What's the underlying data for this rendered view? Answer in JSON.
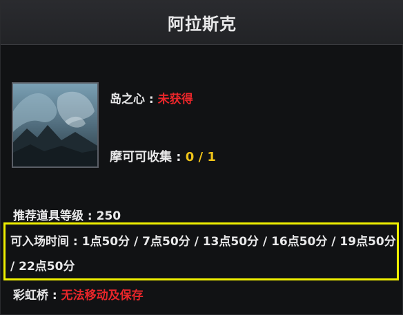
{
  "header": {
    "title": "阿拉斯克"
  },
  "thumbnail": {
    "icon": "island-landscape-icon"
  },
  "island_heart": {
    "label": "岛之心 : ",
    "value": "未获得"
  },
  "collectibles": {
    "label": "摩可可收集 : ",
    "value": "0 / 1"
  },
  "recommended_level": {
    "label": "推荐道具等级 : ",
    "value": "250"
  },
  "entry_time": {
    "label": "可入场时间 : ",
    "value": "1点50分 / 7点50分 / 13点50分 / 16点50分 / 19点50分 / 22点50分"
  },
  "rainbow_bridge": {
    "label": "彩虹桥 : ",
    "value": "无法移动及保存"
  },
  "colors": {
    "status_red": "#e8262a",
    "count_gold": "#f0c419",
    "highlight_yellow": "#f0f000"
  }
}
